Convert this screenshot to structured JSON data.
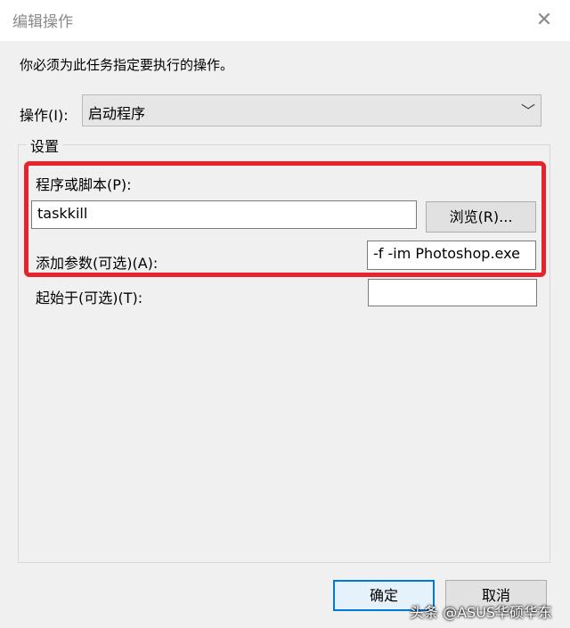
{
  "window": {
    "title": "编辑操作",
    "close_glyph": "✕"
  },
  "instruction": "你必须为此任务指定要执行的操作。",
  "action": {
    "label": "操作(I):",
    "selected": "启动程序",
    "chevron": "﹀"
  },
  "settings": {
    "group_title": "设置",
    "program_label": "程序或脚本(P):",
    "program_value": "taskkill",
    "browse_label": "浏览(R)...",
    "args_label": "添加参数(可选)(A):",
    "args_value": "-f -im Photoshop.exe",
    "start_label": "起始于(可选)(T):",
    "start_value": ""
  },
  "footer": {
    "ok_label": "确定",
    "cancel_label": "取消"
  },
  "watermark": "头条 @ASUS华硕华东",
  "colors": {
    "highlight": "#e8232e",
    "accent": "#0078d7",
    "dialog_bg": "#f0f0f0"
  },
  "icons": {
    "close": "close-icon",
    "dropdown": "chevron-down-icon"
  }
}
